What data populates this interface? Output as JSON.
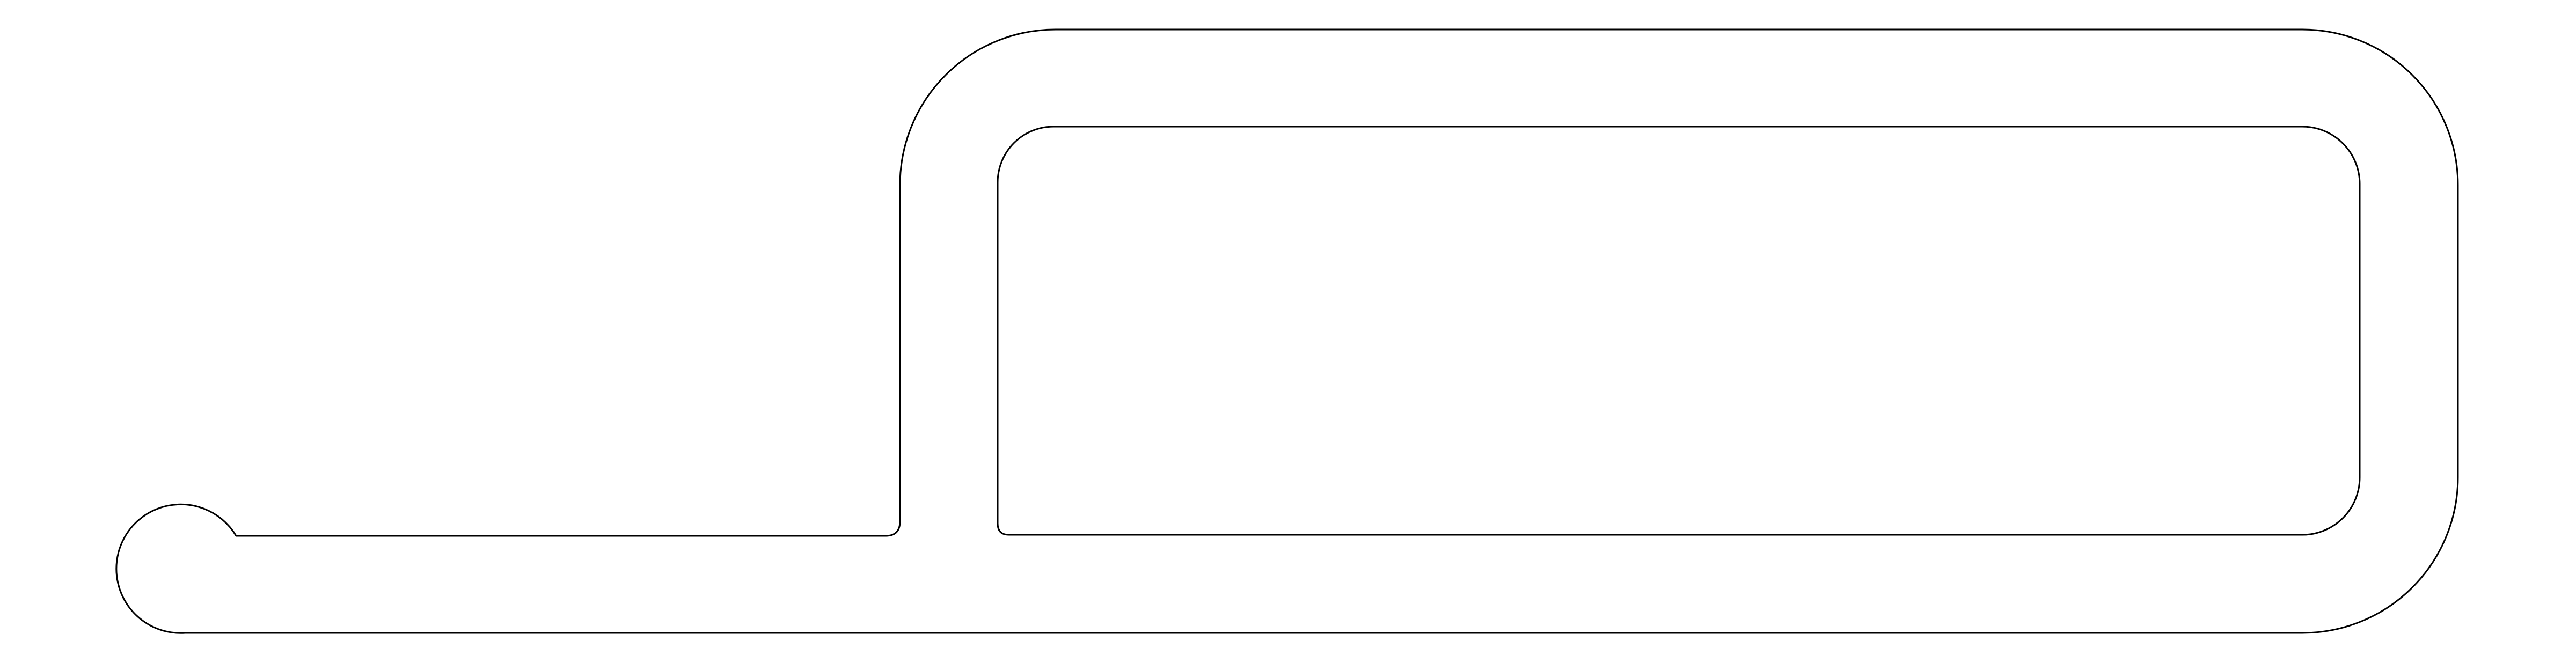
{
  "drawing": {
    "type": "technical-profile-outline",
    "background_color": "#ffffff",
    "line_color": "#000000",
    "labels": []
  }
}
